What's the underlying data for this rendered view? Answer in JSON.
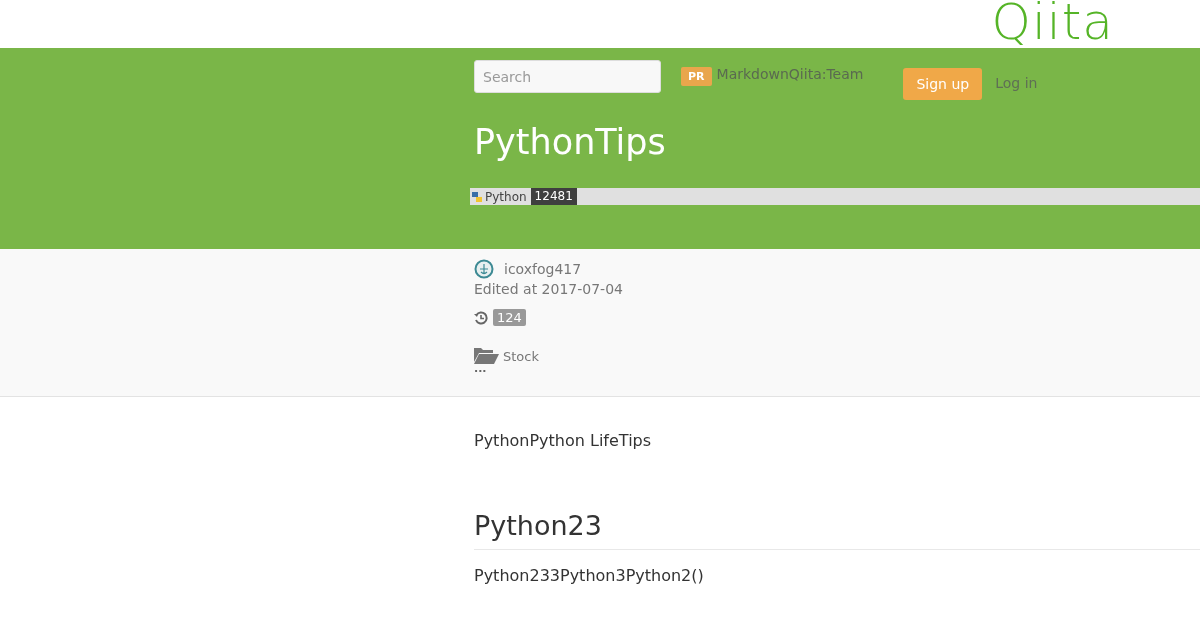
{
  "logo": "Qiita",
  "header": {
    "search": {
      "placeholder": "Search"
    },
    "promo": {
      "badge": "PR",
      "text": "MarkdownQiita:Team"
    },
    "signup": "Sign up",
    "login": "Log in"
  },
  "article": {
    "title": "PythonTips",
    "tags": [
      {
        "name": "Python",
        "count": "12481"
      }
    ]
  },
  "meta": {
    "author": "icoxfog417",
    "edited": "Edited at 2017-07-04",
    "history_count": "124",
    "stock": "Stock",
    "more": "···"
  },
  "body": [
    {
      "kind": "paragraph",
      "text": "PythonPython LifeTips"
    },
    {
      "kind": "heading",
      "text": "Python23"
    },
    {
      "kind": "paragraph",
      "text": "Python233Python3Python2()"
    }
  ]
}
